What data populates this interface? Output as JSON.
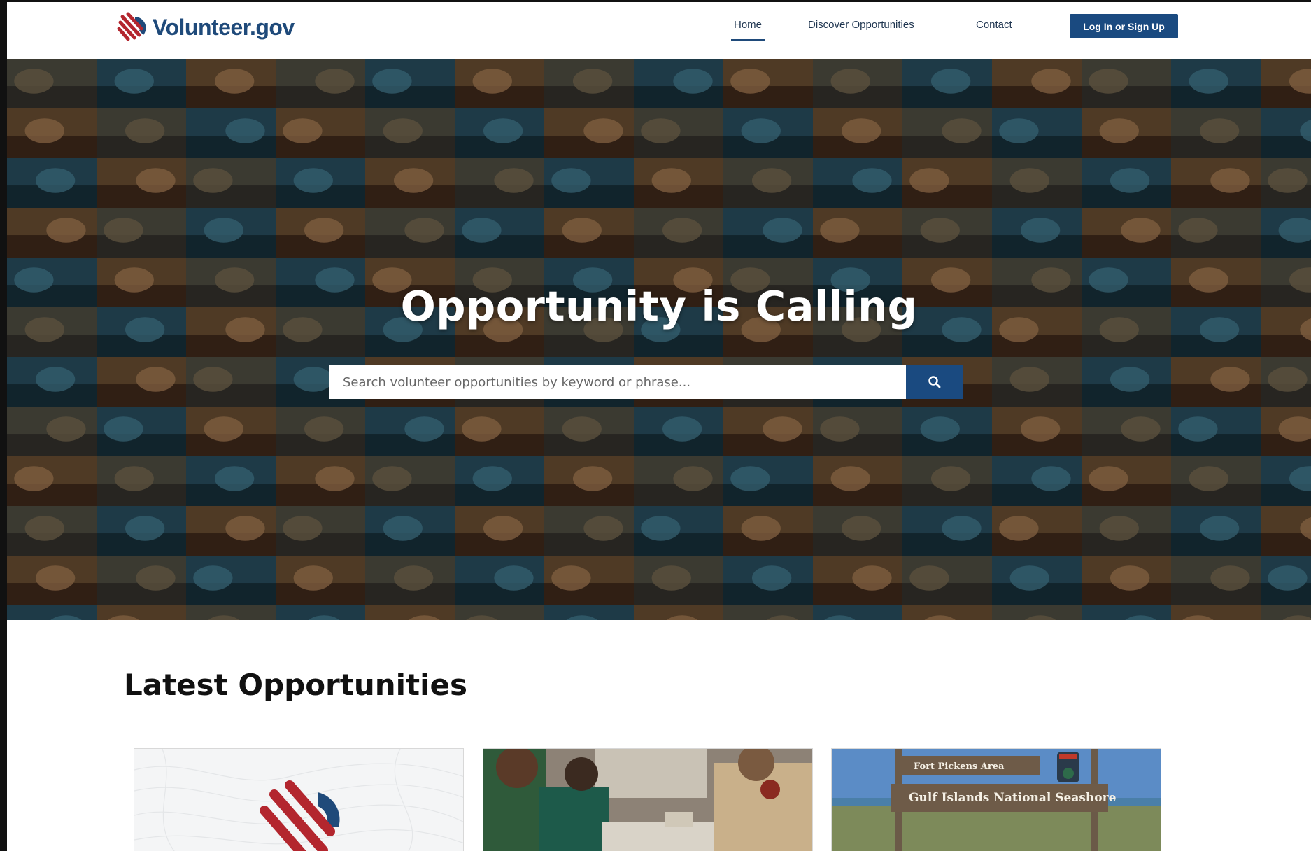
{
  "brand": {
    "name": "Volunteer.gov"
  },
  "nav": {
    "items": [
      {
        "label": "Home",
        "active": true
      },
      {
        "label": "Discover Opportunities",
        "active": false
      },
      {
        "label": "Contact",
        "active": false
      }
    ],
    "login_label": "Log In or Sign Up"
  },
  "hero": {
    "title": "Opportunity is Calling",
    "search": {
      "placeholder": "Search volunteer opportunities by keyword or phrase...",
      "value": "",
      "button_icon": "search-icon"
    }
  },
  "latest": {
    "title": "Latest Opportunities",
    "cards": [
      {
        "image": "volunteer-gov-logo-placeholder"
      },
      {
        "image": "ranger-with-volunteers-photo"
      },
      {
        "image": "gulf-islands-sign-photo",
        "sign_top": "Fort Pickens Area",
        "sign_main": "Gulf Islands National Seashore"
      }
    ]
  },
  "colors": {
    "brand_blue": "#1f4a7a",
    "button_blue": "#1a4a80",
    "logo_red": "#b3262e",
    "logo_blue": "#1f4a7a",
    "hero_dark": "#2a3440"
  }
}
